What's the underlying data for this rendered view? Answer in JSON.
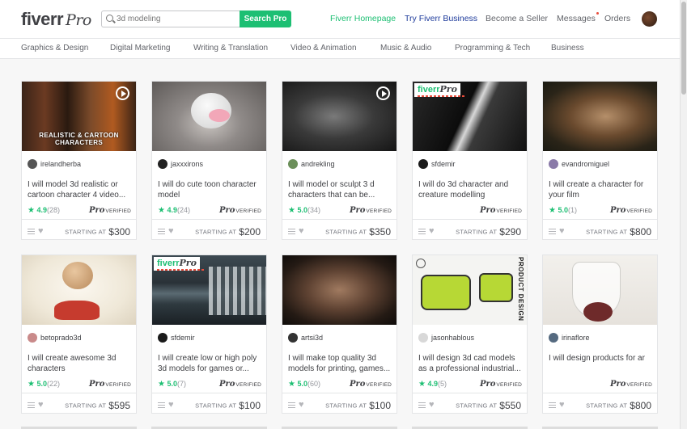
{
  "header": {
    "logo_text": "fiverr",
    "logo_pro": "Pro",
    "search_placeholder": "3d modeling",
    "search_button": "Search Pro",
    "nav": {
      "home": "Fiverr Homepage",
      "business": "Try Fiverr Business",
      "seller": "Become a Seller",
      "messages": "Messages",
      "orders": "Orders"
    }
  },
  "categories": [
    "Graphics & Design",
    "Digital Marketing",
    "Writing & Translation",
    "Video & Animation",
    "Music & Audio",
    "Programming & Tech",
    "Business"
  ],
  "gigs": [
    {
      "seller": "irelandherba",
      "title": "I will model 3d realistic or cartoon character 4 video...",
      "rating": "4.9",
      "count": "(28)",
      "price": "$300",
      "thumb_caption": "REALISTIC & CARTOON CHARACTERS"
    },
    {
      "seller": "jaxxxirons",
      "title": "I will do cute toon character model",
      "rating": "4.9",
      "count": "(24)",
      "price": "$200"
    },
    {
      "seller": "andrekling",
      "title": "I will model or sculpt 3 d characters that can be...",
      "rating": "5.0",
      "count": "(34)",
      "price": "$350"
    },
    {
      "seller": "sfdemir",
      "title": "I will do 3d character and creature modelling",
      "rating": "",
      "count": "",
      "price": "$290",
      "badge": "fiverr"
    },
    {
      "seller": "evandromiguel",
      "title": "I will create a character for your film",
      "rating": "5.0",
      "count": "(1)",
      "price": "$800"
    },
    {
      "seller": "betoprado3d",
      "title": "I will create awesome 3d characters",
      "rating": "5.0",
      "count": "(22)",
      "price": "$595"
    },
    {
      "seller": "sfdemir",
      "title": "I will create low or high poly 3d models for games or...",
      "rating": "5.0",
      "count": "(7)",
      "price": "$100",
      "badge": "fiverr"
    },
    {
      "seller": "artsi3d",
      "title": "I will make top quality 3d models for printing, games...",
      "rating": "5.0",
      "count": "(60)",
      "price": "$100"
    },
    {
      "seller": "jasonhablous",
      "title": "I will design 3d cad models as a professional industrial...",
      "rating": "4.9",
      "count": "(5)",
      "price": "$550",
      "side_text": "PRODUCT DESIGN"
    },
    {
      "seller": "irinaflore",
      "title": "I will design products for ar",
      "rating": "",
      "count": "",
      "price": "$800"
    }
  ],
  "labels": {
    "pro": "Pro",
    "verified": "VERIFIED",
    "starting_at": "STARTING AT",
    "star": "★",
    "heart": "♥",
    "badge_pro": "Pro"
  },
  "colors": {
    "accent": "#1dbf73",
    "business": "#1d3a9b",
    "text": "#404145"
  }
}
